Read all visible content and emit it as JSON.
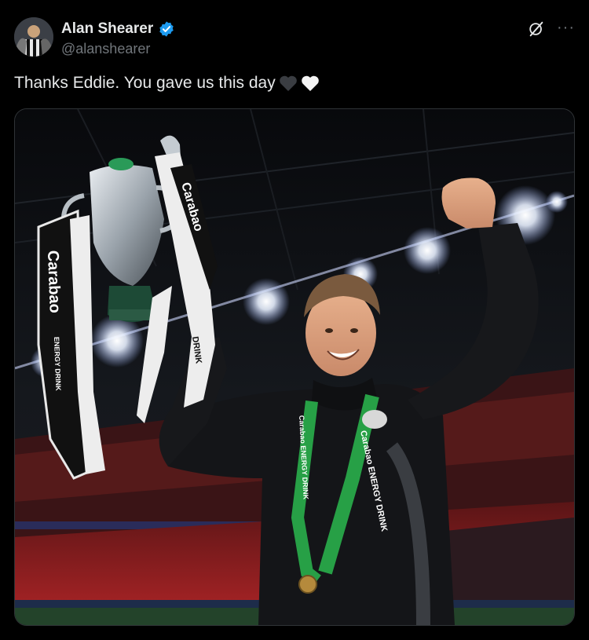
{
  "user": {
    "display_name": "Alan Shearer",
    "handle": "@alanshearer",
    "verified": true,
    "verified_color": "#1d9bf0"
  },
  "tweet": {
    "text": "Thanks Eddie. You gave us this day",
    "emojis": [
      "black-heart",
      "white-heart"
    ]
  },
  "photo": {
    "banner_text": "Carabao",
    "ribbon_text": "ENERGY DRINK",
    "lanyard_text_1": "Carabao ENERGY DRINK",
    "lanyard_text_2": "Carabao ENERGY DRINK",
    "ribbon_right_text": "DRINK"
  },
  "icons": {
    "grok": "grok-icon",
    "more": "more-options-icon"
  }
}
